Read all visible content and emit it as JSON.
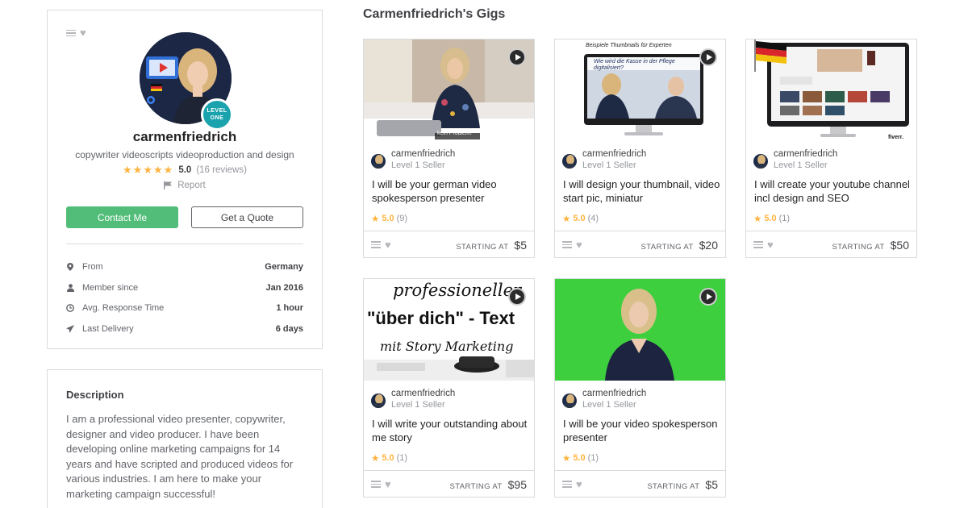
{
  "profile": {
    "username": "carmenfriedrich",
    "tagline": "copywriter videoscripts videoproduction and design",
    "level_badge": [
      "LEVEL",
      "ONE"
    ],
    "rating_stars": "★★★★★",
    "rating_score": "5.0",
    "rating_count": "(16 reviews)",
    "report_label": "Report",
    "contact_button": "Contact Me",
    "quote_button": "Get a Quote",
    "stats": [
      {
        "label": "From",
        "value": "Germany",
        "icon": "location-pin-icon"
      },
      {
        "label": "Member since",
        "value": "Jan 2016",
        "icon": "user-icon"
      },
      {
        "label": "Avg. Response Time",
        "value": "1 hour",
        "icon": "clock-icon"
      },
      {
        "label": "Last Delivery",
        "value": "6 days",
        "icon": "paper-plane-icon"
      }
    ]
  },
  "description": {
    "title": "Description",
    "text": "I am a professional video presenter, copywriter, designer and video producer. I have been developing online marketing campaigns for 14 years and have scripted and produced videos for various industries. I am here to make your marketing campaign successful!"
  },
  "gigs_title": "Carmenfriedrich's Gigs",
  "gigs": [
    {
      "seller": "carmenfriedrich",
      "level": "Level 1 Seller",
      "title": "I will be your german video spokesperson presenter",
      "score": "5.0",
      "count": "(9)",
      "starting": "STARTING AT",
      "price": "$5",
      "thumb_caption": "kein Problem!"
    },
    {
      "seller": "carmenfriedrich",
      "level": "Level 1 Seller",
      "title": "I will design your thumbnail, video start pic, miniatur",
      "score": "5.0",
      "count": "(4)",
      "starting": "STARTING AT",
      "price": "$20",
      "thumb_caption": "Beispiele Thumbnails für Experten",
      "thumb_screen": "Wie wird die Kasse in der Pflege digitalisiert?"
    },
    {
      "seller": "carmenfriedrich",
      "level": "Level 1 Seller",
      "title": "I will create your youtube channel incl design and SEO",
      "score": "5.0",
      "count": "(1)",
      "starting": "STARTING AT",
      "price": "$50",
      "thumb_caption": "fiverr."
    },
    {
      "seller": "carmenfriedrich",
      "level": "Level 1 Seller",
      "title": "I will write your outstanding about me story",
      "score": "5.0",
      "count": "(1)",
      "starting": "STARTING AT",
      "price": "$95",
      "thumb_lines": [
        "professioneller",
        "\"über dich\" - Text",
        "mit Story Marketing"
      ]
    },
    {
      "seller": "carmenfriedrich",
      "level": "Level 1 Seller",
      "title": "I will be your video spokesperson presenter",
      "score": "5.0",
      "count": "(1)",
      "starting": "STARTING AT",
      "price": "$5"
    }
  ],
  "colors": {
    "accent_green": "#52bd79",
    "star": "#ffb33e",
    "badge": "#1aa3ad",
    "chroma_green": "#3ecf3e"
  }
}
